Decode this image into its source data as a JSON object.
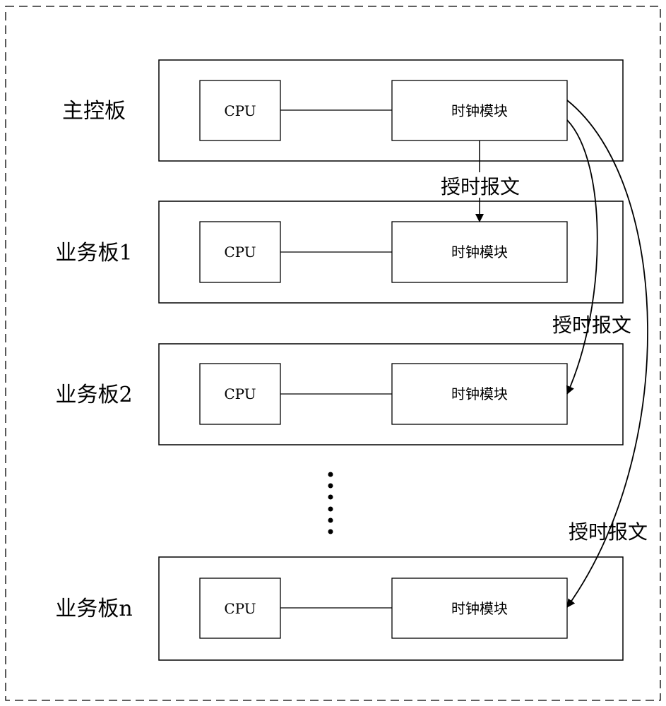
{
  "diagram": {
    "boards": [
      {
        "label": "主控板",
        "cpu": "CPU",
        "clock": "时钟模块"
      },
      {
        "label": "业务板1",
        "cpu": "CPU",
        "clock": "时钟模块"
      },
      {
        "label": "业务板2",
        "cpu": "CPU",
        "clock": "时钟模块"
      },
      {
        "label": "业务板n",
        "cpu": "CPU",
        "clock": "时钟模块"
      }
    ],
    "messages": [
      {
        "label": "授时报文",
        "from": "主控板",
        "to": "业务板1"
      },
      {
        "label": "授时报文",
        "from": "主控板",
        "to": "业务板2"
      },
      {
        "label": "授时报文",
        "from": "主控板",
        "to": "业务板n"
      }
    ],
    "ellipsis": "......"
  }
}
